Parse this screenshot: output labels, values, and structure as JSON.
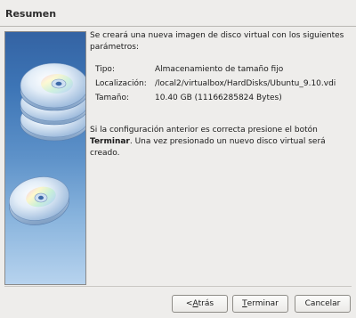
{
  "window": {
    "title": "Resumen"
  },
  "summary": {
    "intro": "Se creará una nueva imagen de disco virtual con los siguientes parámetros:",
    "details": [
      {
        "label": "Tipo:",
        "value": "Almacenamiento de tamaño fijo"
      },
      {
        "label": "Localización:",
        "value": "/local2/virtualbox/HardDisks/Ubuntu_9.10.vdi"
      },
      {
        "label": "Tamaño:",
        "value": "10.40 GB (11166285824 Bytes)"
      }
    ],
    "outro_prefix": "Si la configuración anterior es correcta presione el botón ",
    "outro_bold": "Terminar",
    "outro_suffix": ". Una vez presionado un nuevo disco virtual será creado."
  },
  "buttons": {
    "back_prefix": "< ",
    "back_mnemonic": "A",
    "back_rest": "trás",
    "finish_mnemonic": "T",
    "finish_rest": "erminar",
    "cancel_label": "Cancelar"
  },
  "icons": {
    "side_image": "disk-stack-icon"
  },
  "colors": {
    "panel_top": "#3463a3",
    "panel_bottom": "#b7d3ee",
    "window_bg": "#eeedeb"
  }
}
